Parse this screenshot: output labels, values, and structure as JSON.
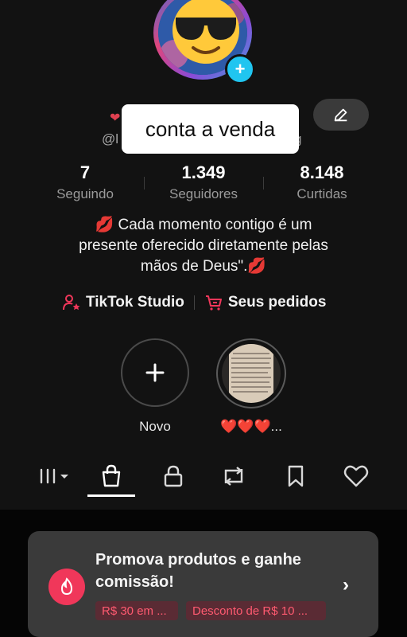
{
  "profile": {
    "name_peek": "❤",
    "username_peek_left": "@l",
    "username_peek_right": "g",
    "sale_overlay": "conta a venda"
  },
  "stats": [
    {
      "value": "7",
      "label": "Seguindo"
    },
    {
      "value": "1.349",
      "label": "Seguidores"
    },
    {
      "value": "8.148",
      "label": "Curtidas"
    }
  ],
  "bio": {
    "line1": "💋 Cada momento contigo é um",
    "line2": "presente oferecido diretamente pelas",
    "line3": "mãos de Deus\".💋"
  },
  "links": {
    "studio": "TikTok Studio",
    "orders": "Seus pedidos"
  },
  "highlights": {
    "new_label": "Novo",
    "story_label": "❤️❤️❤️..."
  },
  "tabs": [
    "videos-grid-icon",
    "shop-bag-icon",
    "lock-icon",
    "repost-icon",
    "bookmark-icon",
    "heart-icon"
  ],
  "promo": {
    "title": "Promova produtos e ganhe comissão!",
    "tag1": "R$ 30 em ...",
    "tag2": "Desconto de R$ 10 ..."
  },
  "colors": {
    "accent": "#f0375a",
    "background": "#121212",
    "badge": "#20c5f0"
  }
}
